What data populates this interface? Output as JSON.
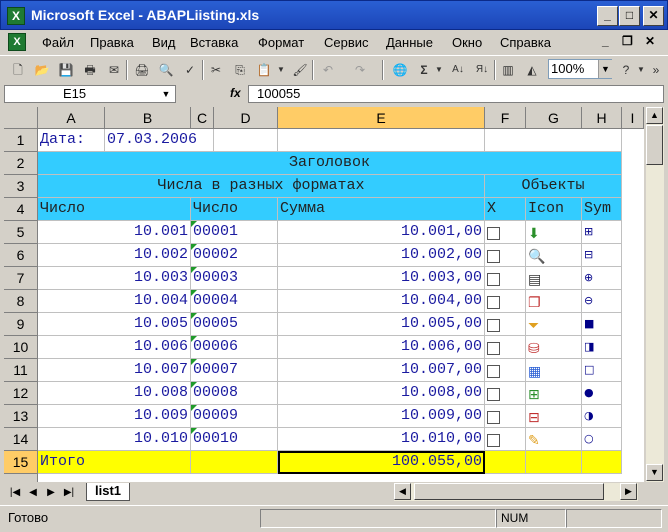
{
  "window": {
    "title": "Microsoft Excel - ABAPLiisting.xls",
    "minimize": "_",
    "maximize": "□",
    "close": "✕"
  },
  "menubar": {
    "items": [
      "Файл",
      "Правка",
      "Вид",
      "Вставка",
      "Формат",
      "Сервис",
      "Данные",
      "Окно",
      "Справка"
    ],
    "mdi_minimize": "_",
    "mdi_restore": "❐",
    "mdi_close": "✕"
  },
  "toolbar": {
    "zoom": "100%"
  },
  "formula_bar": {
    "cell_ref": "E15",
    "fx": "fx",
    "content": "100055"
  },
  "columns": [
    "A",
    "B",
    "C",
    "D",
    "E",
    "F",
    "G",
    "H",
    "I"
  ],
  "selected_column": "E",
  "selected_row": "15",
  "rows": [
    "1",
    "2",
    "3",
    "4",
    "5",
    "6",
    "7",
    "8",
    "9",
    "10",
    "11",
    "12",
    "13",
    "14",
    "15"
  ],
  "sheet": {
    "r1": {
      "a": "Дата:",
      "b": "07.03.2006"
    },
    "r2": {
      "title": "Заголовок"
    },
    "r3": {
      "group1": "Числа в разных форматах",
      "group2": "Объекты"
    },
    "r4": {
      "a": "Число",
      "c": "Число",
      "e": "Сумма",
      "f": "X",
      "g": "Icon",
      "h": "Sym"
    },
    "data": [
      {
        "num": "10.001",
        "code": "00001",
        "sum": "10.001,00",
        "sym": "⊞",
        "icon": "icon-1"
      },
      {
        "num": "10.002",
        "code": "00002",
        "sum": "10.002,00",
        "sym": "⊟",
        "icon": "icon-2"
      },
      {
        "num": "10.003",
        "code": "00003",
        "sum": "10.003,00",
        "sym": "⊕",
        "icon": "icon-3"
      },
      {
        "num": "10.004",
        "code": "00004",
        "sum": "10.004,00",
        "sym": "⊖",
        "icon": "icon-4"
      },
      {
        "num": "10.005",
        "code": "00005",
        "sum": "10.005,00",
        "sym": "■",
        "icon": "icon-5"
      },
      {
        "num": "10.006",
        "code": "00006",
        "sum": "10.006,00",
        "sym": "◨",
        "icon": "icon-6"
      },
      {
        "num": "10.007",
        "code": "00007",
        "sum": "10.007,00",
        "sym": "□",
        "icon": "icon-7"
      },
      {
        "num": "10.008",
        "code": "00008",
        "sum": "10.008,00",
        "sym": "●",
        "icon": "icon-8"
      },
      {
        "num": "10.009",
        "code": "00009",
        "sum": "10.009,00",
        "sym": "◑",
        "icon": "icon-9"
      },
      {
        "num": "10.010",
        "code": "00010",
        "sum": "10.010,00",
        "sym": "○",
        "icon": "icon-10"
      }
    ],
    "r15": {
      "a": "Итого",
      "e": "100.055,00"
    }
  },
  "tabs": {
    "sheet1": "list1"
  },
  "status": {
    "text": "Готово",
    "num": "NUM"
  },
  "colors": {
    "header_fill": "#33ccff",
    "total_fill": "#ffff00",
    "selection": "#ffcc66",
    "text_blue": "#1a1aa0"
  }
}
